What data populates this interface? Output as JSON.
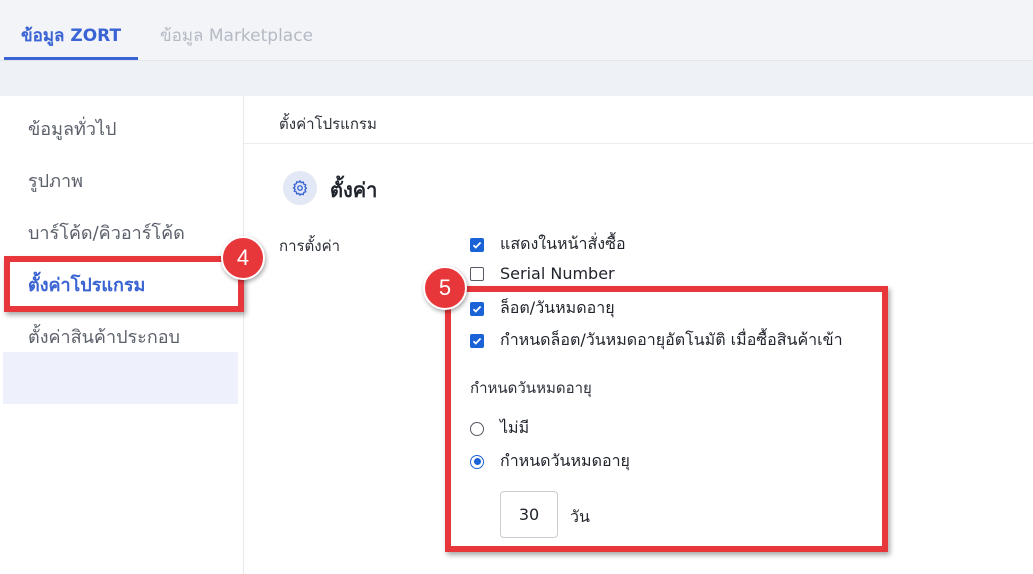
{
  "tabs": [
    {
      "label": "ข้อมูล ZORT",
      "active": true
    },
    {
      "label": "ข้อมูล Marketplace",
      "active": false
    }
  ],
  "sidebar": {
    "items": [
      {
        "label": "ข้อมูลทั่วไป"
      },
      {
        "label": "รูปภาพ"
      },
      {
        "label": "บาร์โค้ด/คิวอาร์โค้ด"
      },
      {
        "label": "ตั้งค่าโปรแกรม",
        "active": true
      },
      {
        "label": "ตั้งค่าสินค้าประกอบ"
      }
    ]
  },
  "main": {
    "breadcrumb": "ตั้งค่าโปรแกรม",
    "section_icon": "gear-icon",
    "section_title": "ตั้งค่า",
    "field_label": "การตั้งค่า",
    "options": [
      {
        "label": "แสดงในหน้าสั่งซื้อ",
        "checked": true
      },
      {
        "label": "Serial Number",
        "checked": false
      },
      {
        "label": "ล็อต/วันหมดอายุ",
        "checked": true
      },
      {
        "label": "กำหนดล็อต/วันหมดอายุอัตโนมัติ เมื่อซื้อสินค้าเข้า",
        "checked": true
      }
    ],
    "expiry": {
      "heading": "กำหนดวันหมดอายุ",
      "radios": [
        {
          "label": "ไม่มี",
          "selected": false
        },
        {
          "label": "กำหนดวันหมดอายุ",
          "selected": true
        }
      ],
      "days_value": "30",
      "days_unit": "วัน"
    }
  },
  "annotations": {
    "badge_4": "4",
    "badge_5": "5",
    "highlight_color": "#e8373b"
  },
  "colors": {
    "accent": "#3a63d3",
    "checkbox": "#1b62d6"
  }
}
